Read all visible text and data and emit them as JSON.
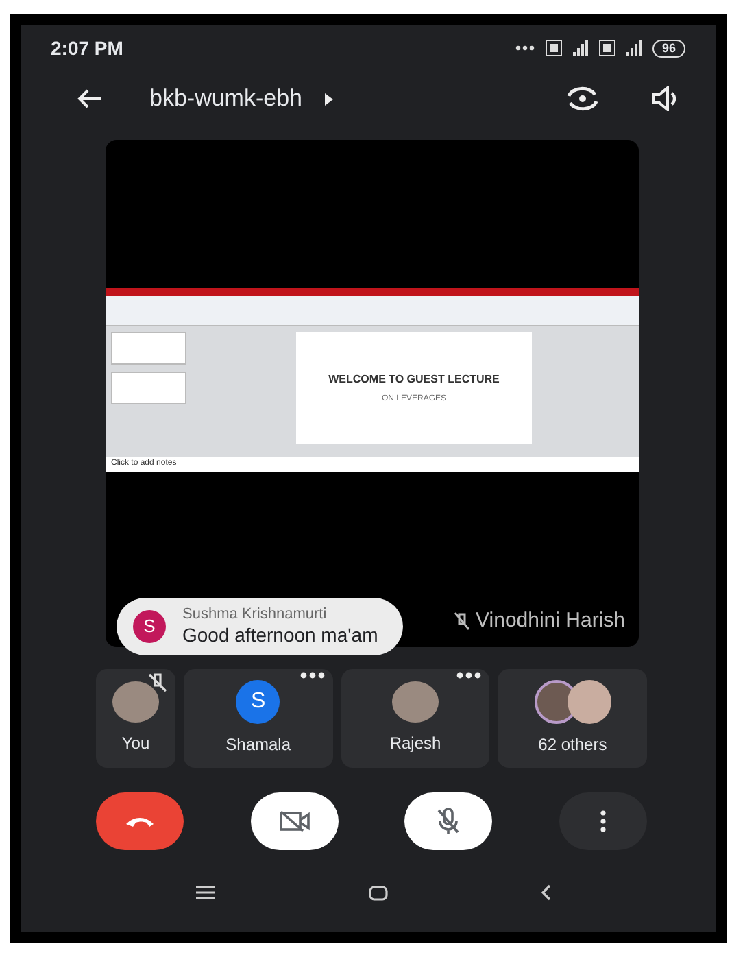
{
  "status_bar": {
    "time": "2:07 PM",
    "battery": "96"
  },
  "header": {
    "meeting_code": "bkb-wumk-ebh"
  },
  "presentation": {
    "slide_title": "WELCOME TO GUEST LECTURE",
    "slide_subtitle": "ON LEVERAGES",
    "notes_placeholder": "Click to add notes",
    "presenter": "Vinodhini Harish",
    "presenter_muted": true
  },
  "chat_bubble": {
    "initial": "S",
    "sender": "Sushma Krishnamurti",
    "message": "Good afternoon ma'am"
  },
  "participants": [
    {
      "kind": "photo",
      "name": "You",
      "muted": true,
      "menu": false
    },
    {
      "kind": "initial",
      "initial": "S",
      "name": "Shamala",
      "muted": false,
      "menu": true
    },
    {
      "kind": "photo",
      "name": "Rajesh",
      "muted": false,
      "menu": true
    },
    {
      "kind": "group",
      "name": "62 others",
      "muted": false,
      "menu": false
    }
  ],
  "controls": {
    "camera_on": false,
    "mic_on": false
  }
}
